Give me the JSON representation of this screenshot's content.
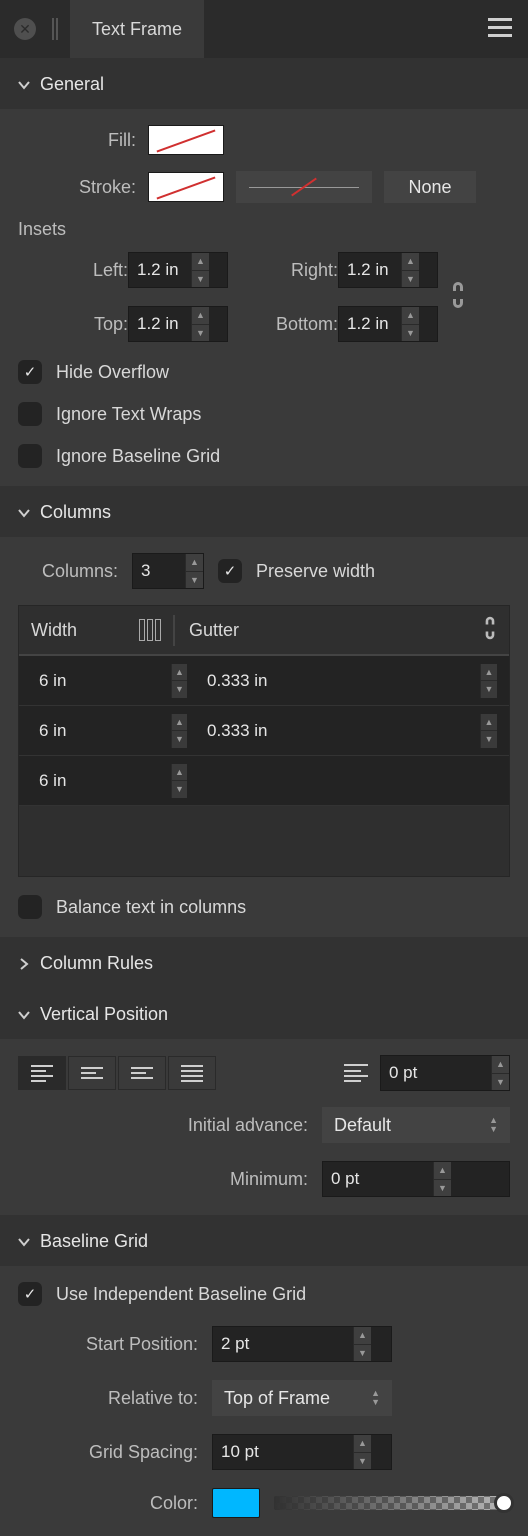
{
  "header": {
    "title": "Text Frame"
  },
  "general": {
    "title": "General",
    "fill_label": "Fill:",
    "stroke_label": "Stroke:",
    "stroke_style": "None",
    "insets_label": "Insets",
    "insets": {
      "left_label": "Left:",
      "left": "1.2 in",
      "right_label": "Right:",
      "right": "1.2 in",
      "top_label": "Top:",
      "top": "1.2 in",
      "bottom_label": "Bottom:",
      "bottom": "1.2 in"
    },
    "hide_overflow": "Hide Overflow",
    "ignore_wraps": "Ignore Text Wraps",
    "ignore_baseline": "Ignore Baseline Grid"
  },
  "columns": {
    "title": "Columns",
    "columns_label": "Columns:",
    "count": "3",
    "preserve_width": "Preserve width",
    "width_header": "Width",
    "gutter_header": "Gutter",
    "rows": [
      {
        "width": "6 in",
        "gutter": "0.333 in"
      },
      {
        "width": "6 in",
        "gutter": "0.333 in"
      },
      {
        "width": "6 in",
        "gutter": ""
      }
    ],
    "balance": "Balance text in columns"
  },
  "column_rules": {
    "title": "Column Rules"
  },
  "vertical": {
    "title": "Vertical Position",
    "offset": "0 pt",
    "initial_advance_label": "Initial advance:",
    "initial_advance": "Default",
    "minimum_label": "Minimum:",
    "minimum": "0 pt"
  },
  "baseline": {
    "title": "Baseline Grid",
    "use_independent": "Use Independent Baseline Grid",
    "start_label": "Start Position:",
    "start": "2 pt",
    "relative_label": "Relative to:",
    "relative": "Top of Frame",
    "spacing_label": "Grid Spacing:",
    "spacing": "10 pt",
    "color_label": "Color:"
  }
}
